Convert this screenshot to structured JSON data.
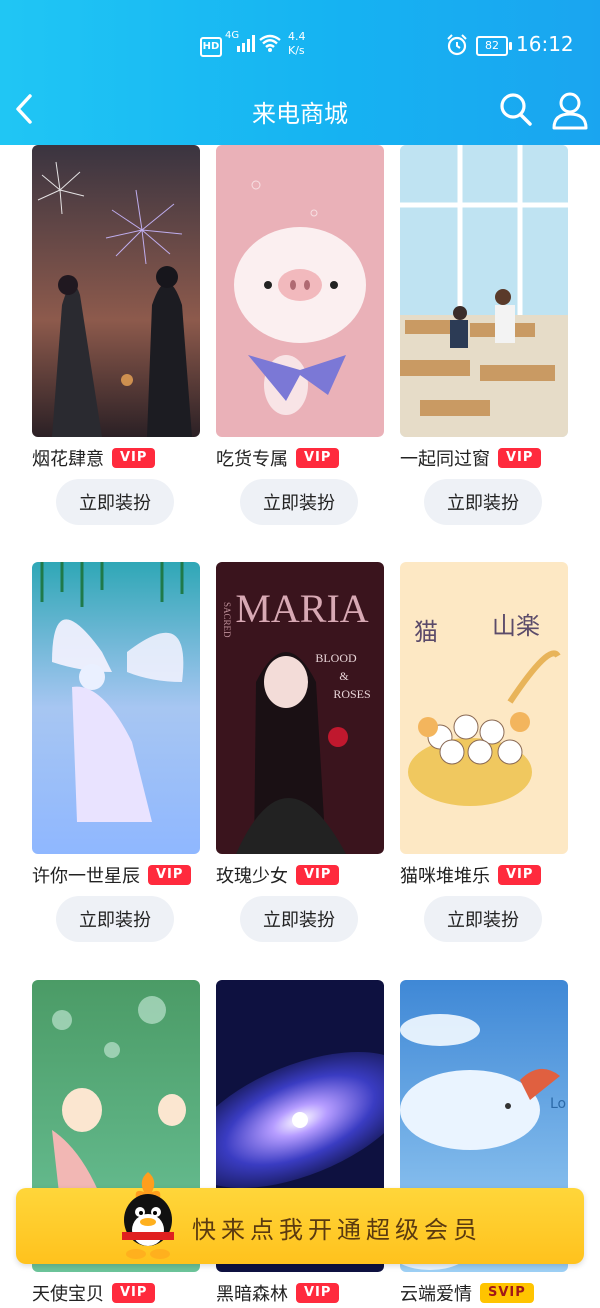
{
  "status_bar": {
    "hd": "HD",
    "network": "4G",
    "speed_value": "4.4",
    "speed_unit": "K/s",
    "battery": "82",
    "time": "16:12"
  },
  "header": {
    "title": "来电商城"
  },
  "items": [
    {
      "name": "烟花肆意",
      "badge": "VIP",
      "button": "立即装扮"
    },
    {
      "name": "吃货专属",
      "badge": "VIP",
      "button": "立即装扮"
    },
    {
      "name": "一起同过窗",
      "badge": "VIP",
      "button": "立即装扮"
    },
    {
      "name": "许你一世星辰",
      "badge": "VIP",
      "button": "立即装扮"
    },
    {
      "name": "玫瑰少女",
      "badge": "VIP",
      "button": "立即装扮"
    },
    {
      "name": "猫咪堆堆乐",
      "badge": "VIP",
      "button": "立即装扮"
    },
    {
      "name": "天使宝贝",
      "badge": "VIP"
    },
    {
      "name": "黑暗森林",
      "badge": "VIP"
    },
    {
      "name": "云端爱情",
      "badge": "SVIP"
    }
  ],
  "thumb_text": {
    "maria": "MARIA",
    "sacred": "SACRED",
    "blood": "BLOOD",
    "amp": "&",
    "roses": "ROSES",
    "cat_title_1": "猫",
    "cat_title_2": "山楽",
    "lo": "Lo"
  },
  "vip_banner": {
    "text": "快来点我开通超级会员"
  },
  "colors": {
    "header_start": "#20c6f4",
    "header_end": "#1aa5f0",
    "vip_badge": "#ff2a3d",
    "svip_badge": "#ffc400",
    "banner": "#ffc21d"
  }
}
